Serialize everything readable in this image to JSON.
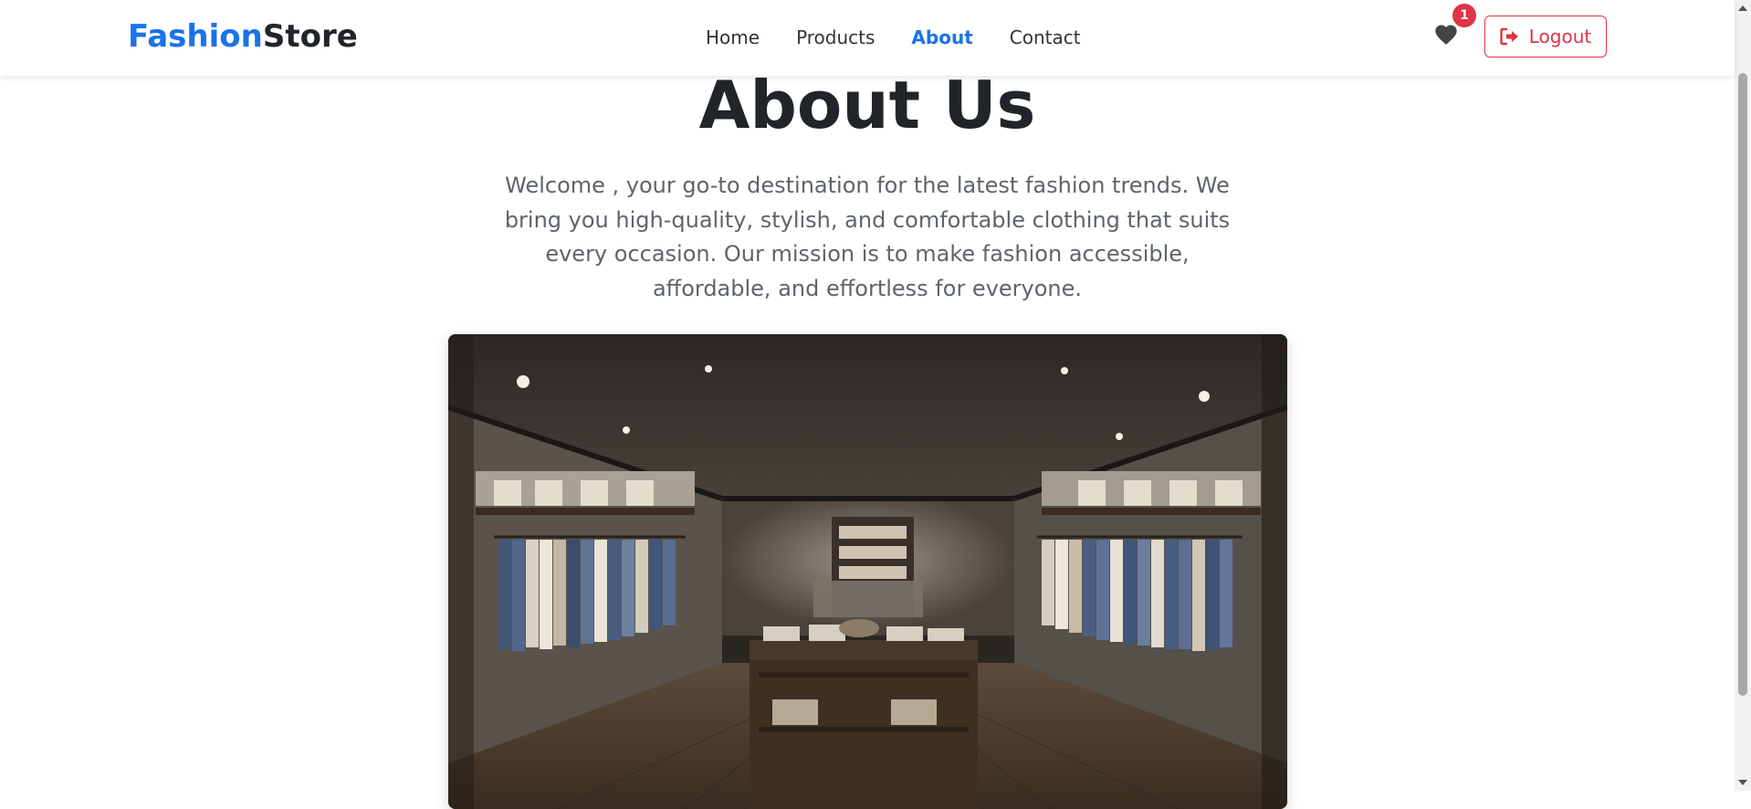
{
  "brand": {
    "part1": "Fashion",
    "part2": "Store"
  },
  "nav": {
    "items": [
      {
        "label": "Home",
        "active": false
      },
      {
        "label": "Products",
        "active": false
      },
      {
        "label": "About",
        "active": true
      },
      {
        "label": "Contact",
        "active": false
      }
    ]
  },
  "wishlist": {
    "icon": "heart-icon",
    "count": "1"
  },
  "logout": {
    "icon": "sign-out-icon",
    "label": "Logout"
  },
  "about": {
    "title": "About Us",
    "text": "Welcome , your go-to destination for the latest fashion trends. We bring you high-quality, stylish, and comfortable clothing that suits every occasion. Our mission is to make fashion accessible, affordable, and effortless for everyone."
  },
  "colors": {
    "accent": "#1a73e8",
    "danger": "#dc3545",
    "heading": "#212529",
    "body_text": "#5f6469"
  }
}
